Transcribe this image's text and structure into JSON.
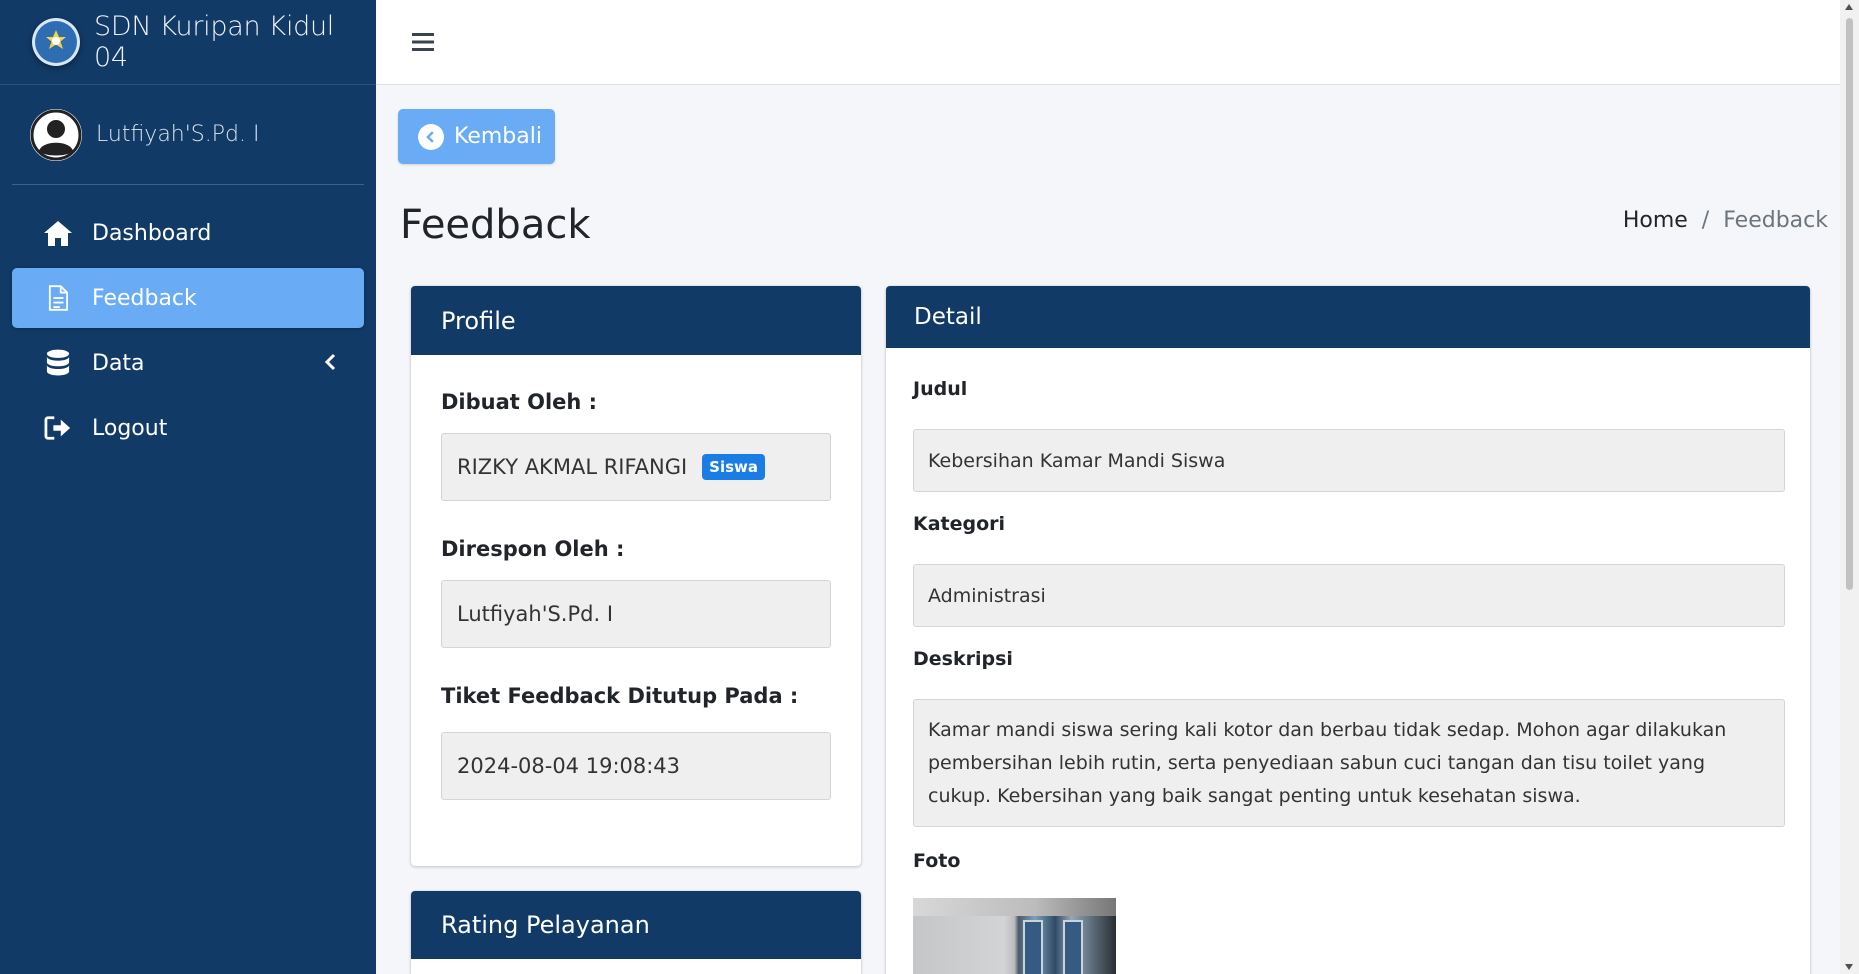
{
  "app": {
    "brand_name": "SDN Kuripan Kidul 04",
    "user_name": "Lutfiyah'S.Pd. I"
  },
  "sidebar": {
    "items": [
      {
        "label": "Dashboard",
        "icon": "home-icon",
        "active": false
      },
      {
        "label": "Feedback",
        "icon": "file-icon",
        "active": true
      },
      {
        "label": "Data",
        "icon": "database-icon",
        "active": false,
        "expandable": true
      },
      {
        "label": "Logout",
        "icon": "logout-icon",
        "active": false
      }
    ]
  },
  "toolbar": {
    "back_label": "Kembali"
  },
  "page": {
    "title": "Feedback",
    "breadcrumb": {
      "home": "Home",
      "separator": "/",
      "current": "Feedback"
    }
  },
  "profile": {
    "header": "Profile",
    "created_by_label": "Dibuat Oleh :",
    "created_by_value": "RIZKY AKMAL RIFANGI",
    "created_by_role": "Siswa",
    "responded_by_label": "Direspon Oleh :",
    "responded_by_value": "Lutfiyah'S.Pd. I",
    "closed_at_label": "Tiket Feedback Ditutup Pada :",
    "closed_at_value": "2024-08-04 19:08:43"
  },
  "rating": {
    "header": "Rating Pelayanan"
  },
  "detail": {
    "header": "Detail",
    "title_label": "Judul",
    "title_value": "Kebersihan Kamar Mandi Siswa",
    "category_label": "Kategori",
    "category_value": "Administrasi",
    "description_label": "Deskripsi",
    "description_value": "Kamar mandi siswa sering kali kotor dan berbau tidak sedap. Mohon agar dilakukan pembersihan lebih rutin, serta penyediaan sabun cuci tangan dan tisu toilet yang cukup. Kebersihan yang baik sangat penting untuk kesehatan siswa.",
    "photo_label": "Foto"
  },
  "colors": {
    "sidebar_bg": "#113a66",
    "accent": "#6aabf5",
    "badge": "#1a7de6",
    "card_header": "#113a66"
  }
}
